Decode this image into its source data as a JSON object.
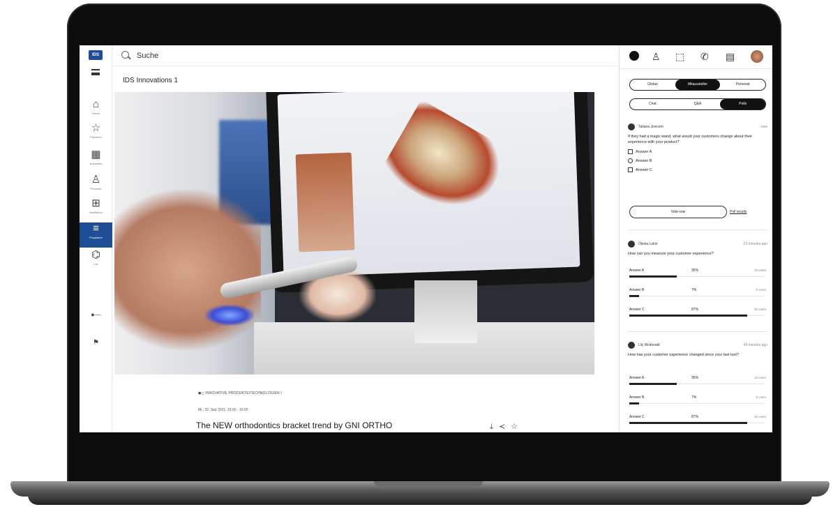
{
  "app": {
    "logo_text": "IDS"
  },
  "search": {
    "placeholder": "Suche"
  },
  "page": {
    "title": "IDS Innovations 1"
  },
  "rail": {
    "items": [
      {
        "label": "Home",
        "icon": "home-icon"
      },
      {
        "label": "Favoriten",
        "icon": "star-icon"
      },
      {
        "label": "Aussteller",
        "icon": "building-icon"
      },
      {
        "label": "Produkte",
        "icon": "product-icon"
      },
      {
        "label": "Mediathek",
        "icon": "media-icon"
      },
      {
        "label": "Programm",
        "icon": "program-icon"
      },
      {
        "label": "Lab",
        "icon": "lab-icon"
      },
      {
        "label": "",
        "icon": "language-icon"
      },
      {
        "label": "",
        "icon": "help-icon"
      }
    ],
    "active_index": 5
  },
  "event": {
    "category": "INNOVATIVE PRODUKTE/TECHNOLOGIEN I",
    "date": "Mi., 22. Sep 2021, 15:00 - 16:00",
    "title": "The NEW orthodontics bracket trend by GNI ORTHO"
  },
  "panel": {
    "tabs_top": [
      "Global",
      "Mitaussteller",
      "Personal"
    ],
    "tabs_top_active": 1,
    "tabs_sub": [
      "Chat",
      "Q&A",
      "Polls"
    ],
    "tabs_sub_active": 2,
    "poll_active": {
      "author": "Tatiana Jovicem",
      "time": "now",
      "question": "If they had a magic wand, what would your customers change about their experience with your product?",
      "options": [
        "Answer A",
        "Answer B",
        "Answer C"
      ],
      "vote_label": "Vote now",
      "results_link": "Poll results"
    },
    "poll_results": [
      {
        "author": "Olesia Lukin",
        "time": "22 minutes ago",
        "question": "How can you measure your customer experience?",
        "answers": [
          {
            "label": "Answer A",
            "pct": 35,
            "votes": "15 votes"
          },
          {
            "label": "Answer B",
            "pct": 7,
            "votes": "8 votes"
          },
          {
            "label": "Answer C",
            "pct": 87,
            "votes": "26 votes"
          }
        ]
      },
      {
        "author": "Lily Mcdonald",
        "time": "48 minutes ago",
        "question": "How has your customer experience changed since your last test?",
        "answers": [
          {
            "label": "Answer A",
            "pct": 35,
            "votes": "15 votes"
          },
          {
            "label": "Answer B",
            "pct": 7,
            "votes": "8 votes"
          },
          {
            "label": "Answer C",
            "pct": 87,
            "votes": "26 votes"
          }
        ]
      }
    ]
  },
  "colors": {
    "brand": "#1f4e96",
    "dark": "#111111"
  }
}
